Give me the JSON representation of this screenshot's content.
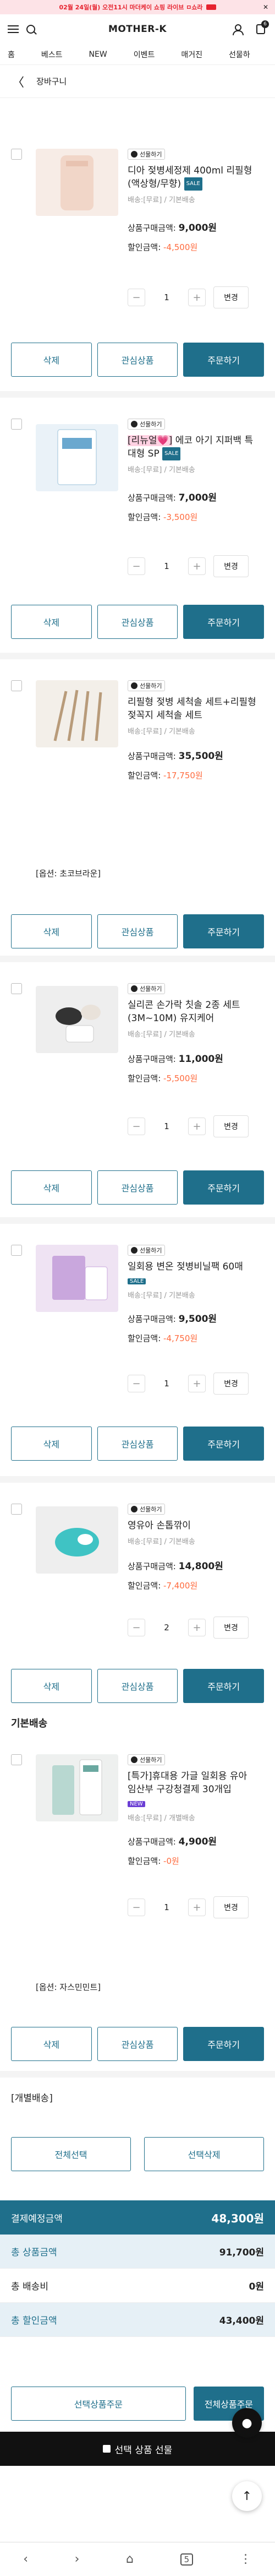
{
  "banner": {
    "text": "02월 24일(월) 오전11시 마더케이 쇼핑 라이브 ㅁ쇼라",
    "close": "✕"
  },
  "header": {
    "logo": "MOTHER-K",
    "cart_count": "6"
  },
  "gnb": [
    "홈",
    "베스트",
    "NEW",
    "이벤트",
    "매거진",
    "선물하"
  ],
  "page": {
    "back": "〈",
    "title": "장바구니"
  },
  "gift_badge": "선물하기",
  "labels": {
    "price": "상품구매금액: ",
    "discount": "할인금액: ",
    "delete": "삭제",
    "wishlist": "관심상품",
    "order": "주문하기",
    "change": "변경",
    "minus": "−",
    "plus": "+"
  },
  "items": [
    {
      "name": "디아 젖병세정제 400ml 리필형 (액상형/무향)",
      "tag": "SALE",
      "ship": "배송:[무료] / 기본배송",
      "price": "9,000원",
      "discount": "-4,500원",
      "qty": "1",
      "option": ""
    },
    {
      "name_mark": "[리뉴얼💗]",
      "name": " 에코 아기 지퍼백 특대형 SP",
      "tag": "SALE",
      "ship": "배송:[무료] / 기본배송",
      "price": "7,000원",
      "discount": "-3,500원",
      "qty": "1",
      "option": ""
    },
    {
      "name": "리필형 젖병 세척솔 세트+리필형 젖꼭지 세척솔 세트",
      "tag": "",
      "ship": "배송:[무료] / 기본배송",
      "price": "35,500원",
      "discount": "-17,750원",
      "qty": "1",
      "option": "[옵션: 초코브라운]"
    },
    {
      "name": "실리콘 손가락 칫솔 2종 세트 (3M~10M) 유지케어",
      "tag": "",
      "ship": "배송:[무료] / 기본배송",
      "price": "11,000원",
      "discount": "-5,500원",
      "qty": "1",
      "option": ""
    },
    {
      "name": "일회용 변온 젖병비닐팩 60매",
      "tag": "SALE",
      "ship": "배송:[무료] / 기본배송",
      "price": "9,500원",
      "discount": "-4,750원",
      "qty": "1",
      "option": ""
    },
    {
      "name": "영유아 손톱깎이",
      "tag": "",
      "ship": "배송:[무료] / 기본배송",
      "price": "14,800원",
      "discount": "-7,400원",
      "qty": "2",
      "option": ""
    },
    {
      "name": "[특가]휴대용 가글 일회용 유아 임산부 구강청결제 30개입",
      "tag": "NEW",
      "ship": "배송:[무료] / 개별배송",
      "price": "4,900원",
      "discount": "-0원",
      "qty": "1",
      "option": "[옵션: 자스민민트]"
    }
  ],
  "sections": {
    "basic": "기본배송",
    "individual": "[개별배송]"
  },
  "bulk": {
    "select_all": "전체선택",
    "delete_selected": "선택삭제"
  },
  "summary": {
    "total_label": "결제예정금액",
    "total": "48,300원",
    "product_label": "총 상품금액",
    "product": "91,700원",
    "shipping_label": "총 배송비",
    "shipping": "0원",
    "discount_label": "총 할인금액",
    "discount": "43,400원"
  },
  "bottom": {
    "order_selected": "선택상품주문",
    "order_all": "전체상품주문",
    "gift": "선택 상품 선물"
  },
  "browser": {
    "tabs": "5"
  }
}
